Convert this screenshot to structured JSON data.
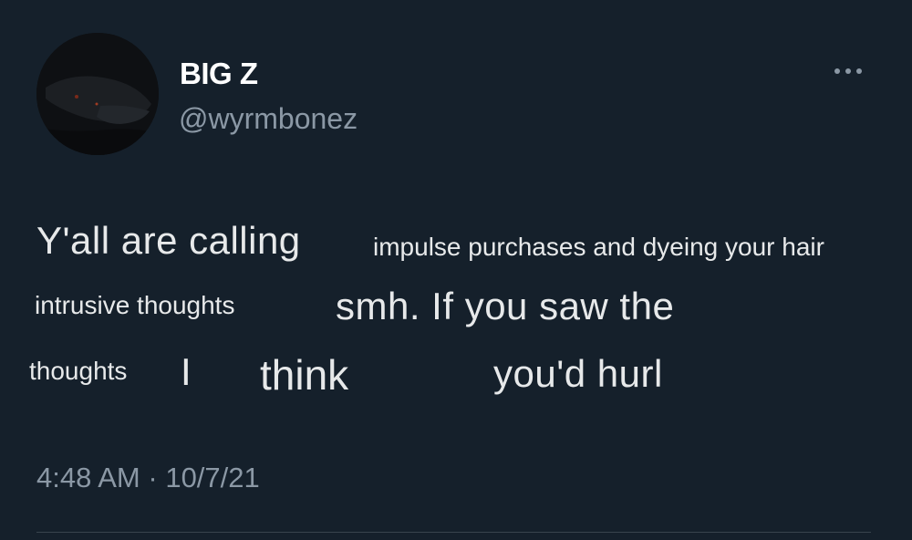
{
  "author": {
    "display_name": "BIG Z",
    "handle": "@wyrmbonez"
  },
  "tweet": {
    "segments": [
      "Y'all are calling",
      "impulse purchases and dyeing your hair",
      "intrusive thoughts",
      "smh. If you saw the",
      "thoughts",
      "I",
      "think",
      "you'd hurl"
    ]
  },
  "meta": {
    "time": "4:48 AM",
    "separator": "·",
    "date": "10/7/21"
  },
  "icons": {
    "more": "more-horizontal-icon",
    "avatar": "alligator-photo"
  },
  "colors": {
    "background": "#15202b",
    "text": "#e7e9ea",
    "secondary": "#8b98a5"
  }
}
